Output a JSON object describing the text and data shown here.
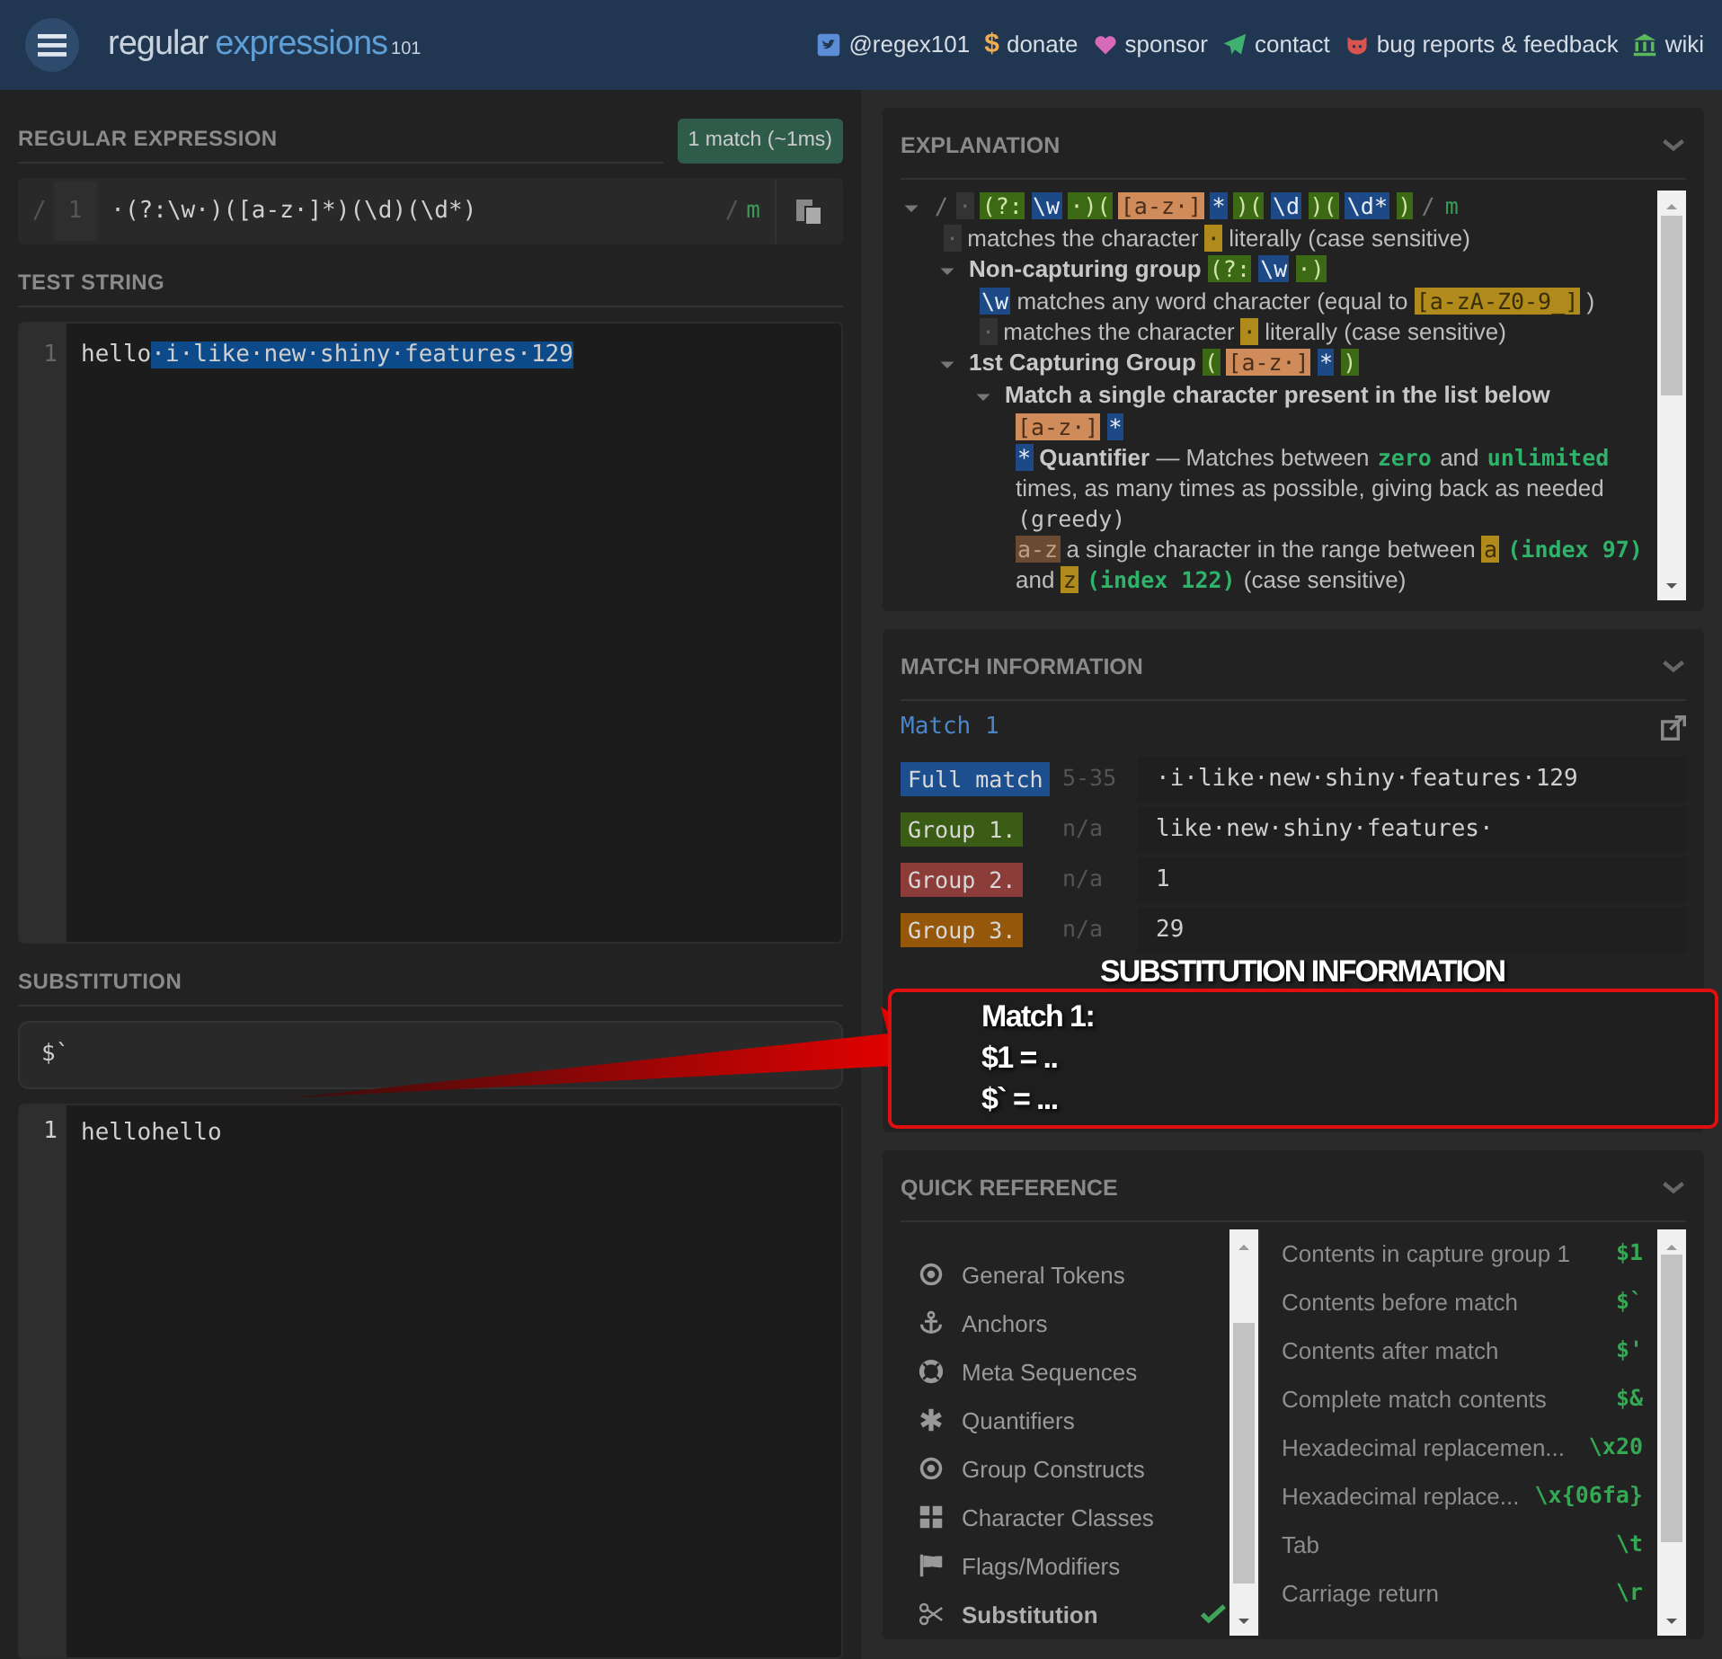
{
  "header": {
    "logo_main": "regular",
    "logo_accent": "expressions",
    "logo_version": "101",
    "links": [
      {
        "kind": "bird",
        "label": "@regex101"
      },
      {
        "kind": "glyph",
        "glyph": "$",
        "label": "donate"
      },
      {
        "kind": "heart",
        "label": "sponsor"
      },
      {
        "kind": "plane",
        "label": "contact"
      },
      {
        "kind": "cat",
        "label": "bug reports & feedback"
      },
      {
        "kind": "bank",
        "label": "wiki"
      }
    ]
  },
  "regex_section": {
    "title": "REGULAR EXPRESSION",
    "badge": "1 match (~1ms)",
    "open_delimiter": "/",
    "line_number": "1",
    "pattern": "·(?:\\w·)([a-z·]*)(\\d)(\\d*)",
    "close_delimiter": "/",
    "flags": "m"
  },
  "test_string": {
    "title": "TEST STRING",
    "line_number": "1",
    "text_before": "hello",
    "match_text": "·i·like·new·shiny·features·129"
  },
  "substitution": {
    "title": "SUBSTITUTION",
    "value": "$`",
    "result_line_number": "1",
    "result": "hellohello"
  },
  "explanation": {
    "title": "EXPLANATION",
    "tree": [
      {
        "expanded": true,
        "segments": [
          {
            "kind": "punct",
            "text": "/"
          },
          {
            "kind": "space",
            "text": "·"
          },
          {
            "kind": "group",
            "text": "(?:"
          },
          {
            "kind": "meta",
            "text": "\\w"
          },
          {
            "kind": "group",
            "text": "·)("
          },
          {
            "kind": "class",
            "text": "[a-z·]"
          },
          {
            "kind": "meta",
            "text": "*"
          },
          {
            "kind": "group",
            "text": ")("
          },
          {
            "kind": "meta",
            "text": "\\d"
          },
          {
            "kind": "group",
            "text": ")("
          },
          {
            "kind": "meta",
            "text": "\\d*"
          },
          {
            "kind": "group",
            "text": ")"
          },
          {
            "kind": "punct",
            "text": "/"
          },
          {
            "kind": "flag",
            "text": "m"
          }
        ],
        "children": [
          {
            "segments": [
              {
                "kind": "space",
                "text": "·"
              },
              {
                "kind": "plain",
                "text": "matches the character"
              },
              {
                "kind": "literal",
                "text": "·"
              },
              {
                "kind": "plain",
                "text": "literally (case sensitive)"
              }
            ]
          },
          {
            "expanded": true,
            "segments": [
              {
                "kind": "bold",
                "text": "Non-capturing group"
              },
              {
                "kind": "group",
                "text": "(?:"
              },
              {
                "kind": "meta",
                "text": "\\w"
              },
              {
                "kind": "group",
                "text": "·)"
              }
            ],
            "children": [
              {
                "segments": [
                  {
                    "kind": "meta",
                    "text": "\\w"
                  },
                  {
                    "kind": "plain",
                    "text": "matches any word character (equal to"
                  },
                  {
                    "kind": "literal",
                    "text": "[a-zA-Z0-9_]"
                  },
                  {
                    "kind": "plain",
                    "text": ")"
                  }
                ]
              },
              {
                "segments": [
                  {
                    "kind": "space",
                    "text": "·"
                  },
                  {
                    "kind": "plain",
                    "text": "matches the character"
                  },
                  {
                    "kind": "literal",
                    "text": "·"
                  },
                  {
                    "kind": "plain",
                    "text": "literally (case sensitive)"
                  }
                ]
              }
            ]
          },
          {
            "expanded": true,
            "segments": [
              {
                "kind": "bold",
                "text": "1st Capturing Group"
              },
              {
                "kind": "group",
                "text": "("
              },
              {
                "kind": "class",
                "text": "[a-z·]"
              },
              {
                "kind": "meta",
                "text": "*"
              },
              {
                "kind": "group",
                "text": ")"
              }
            ],
            "children": [
              {
                "expanded": true,
                "segments": [
                  {
                    "kind": "bold",
                    "text": "Match a single character present in the list below"
                  }
                ],
                "children": [
                  {
                    "segments": [
                      {
                        "kind": "class",
                        "text": "[a-z·]"
                      },
                      {
                        "kind": "meta",
                        "text": "*"
                      }
                    ]
                  },
                  {
                    "segments": [
                      {
                        "kind": "meta",
                        "text": "*"
                      },
                      {
                        "kind": "bold",
                        "text": "Quantifier"
                      },
                      {
                        "kind": "plain",
                        "text": "— Matches between"
                      },
                      {
                        "kind": "keyword",
                        "text": "zero"
                      },
                      {
                        "kind": "plain",
                        "text": "and"
                      },
                      {
                        "kind": "keyword",
                        "text": "unlimited"
                      },
                      {
                        "kind": "plain",
                        "text": "times, as many times as possible, giving back as needed"
                      },
                      {
                        "kind": "code",
                        "text": "(greedy)"
                      }
                    ]
                  },
                  {
                    "segments": [
                      {
                        "kind": "range",
                        "text": "a-z"
                      },
                      {
                        "kind": "plain",
                        "text": "a single character in the range between"
                      },
                      {
                        "kind": "literal",
                        "text": "a"
                      },
                      {
                        "kind": "keyword",
                        "text": "(index 97)"
                      },
                      {
                        "kind": "plain",
                        "text": "and"
                      },
                      {
                        "kind": "literal",
                        "text": "z"
                      },
                      {
                        "kind": "keyword",
                        "text": "(index 122)"
                      },
                      {
                        "kind": "plain",
                        "text": "(case sensitive)"
                      }
                    ]
                  }
                ]
              }
            ]
          }
        ]
      }
    ]
  },
  "match_information": {
    "title": "MATCH INFORMATION",
    "match_title": "Match 1",
    "rows": [
      {
        "label": "Full match",
        "color": "#1d4f8f",
        "range": "5-35",
        "value": "·i·like·new·shiny·features·129"
      },
      {
        "label": "Group 1.",
        "color": "#3b5c14",
        "range": "n/a",
        "value": "like·new·shiny·features·"
      },
      {
        "label": "Group 2.",
        "color": "#8c3d39",
        "range": "n/a",
        "value": "1"
      },
      {
        "label": "Group 3.",
        "color": "#95580a",
        "range": "n/a",
        "value": "29"
      }
    ]
  },
  "annotation": {
    "title": "SUBSTITUTION INFORMATION",
    "lines": [
      "Match 1:",
      "$1 = ..",
      "$` = ..."
    ]
  },
  "quick_reference": {
    "title": "QUICK REFERENCE",
    "categories": [
      {
        "kind": "target",
        "label": "General Tokens",
        "selected": false
      },
      {
        "kind": "anchor",
        "label": "Anchors",
        "selected": false
      },
      {
        "kind": "lifebuoy",
        "label": "Meta Sequences",
        "selected": false
      },
      {
        "kind": "asterisk",
        "label": "Quantifiers",
        "selected": false
      },
      {
        "kind": "target",
        "label": "Group Constructs",
        "selected": false
      },
      {
        "kind": "grid",
        "label": "Character Classes",
        "selected": false
      },
      {
        "kind": "flag",
        "label": "Flags/Modifiers",
        "selected": false
      },
      {
        "kind": "scissors",
        "label": "Substitution",
        "selected": true
      }
    ],
    "tokens": [
      {
        "description": "Contents in capture group 1",
        "token": "$1"
      },
      {
        "description": "Contents before match",
        "token": "$`"
      },
      {
        "description": "Contents after match",
        "token": "$'"
      },
      {
        "description": "Complete match contents",
        "token": "$&"
      },
      {
        "description": "Hexadecimal replacemen...",
        "token": "\\x20"
      },
      {
        "description": "Hexadecimal replace...",
        "token": "\\x{06fa}"
      },
      {
        "description": "Tab",
        "token": "\\t"
      },
      {
        "description": "Carriage return",
        "token": "\\r"
      }
    ]
  }
}
